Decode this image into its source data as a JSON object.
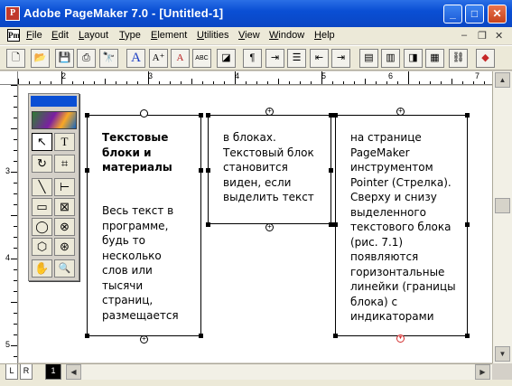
{
  "window": {
    "title": "Adobe PageMaker 7.0 - [Untitled-1]",
    "app_icon": "P",
    "buttons": {
      "minimize": "_",
      "maximize": "□",
      "close": "✕"
    }
  },
  "menu": {
    "doc_icon": "Pm",
    "items": [
      "File",
      "Edit",
      "Layout",
      "Type",
      "Element",
      "Utilities",
      "View",
      "Window",
      "Help"
    ],
    "mdi": {
      "minimize": "–",
      "restore": "❐",
      "close": "✕"
    }
  },
  "toolbar": {
    "buttons": [
      "new-icon",
      "open-icon",
      "save-icon",
      "print-icon",
      "find-icon",
      "character-icon",
      "type-specs-icon",
      "type-specs-color-icon",
      "spelling-icon",
      "fill-stroke-icon",
      "paragraph-icon",
      "indents-tabs-icon",
      "bullets-icon",
      "outdent-icon",
      "indent-icon",
      "master-pages-icon",
      "styles-icon",
      "layers-icon",
      "colors-icon",
      "link-icon",
      "export-pdf-icon"
    ],
    "glyphs": {
      "type": "A",
      "type_specs": "A⁺",
      "type_color": "A",
      "spelling": "ABC",
      "paragraph": "¶"
    }
  },
  "rulers": {
    "horizontal_labels": [
      "2",
      "3",
      "4",
      "5",
      "6",
      "7"
    ],
    "vertical_labels": [
      "3",
      "4",
      "5"
    ]
  },
  "text_blocks": [
    {
      "heading": "Текстовые\nблоки и\nматериалы",
      "body": "Весь текст в\nпрограмме,\nбудь то\nнесколько\nслов или\nтысячи\nстраниц,\nразмещается"
    },
    {
      "heading": "",
      "body": "в блоках.\nТекстовый блок\nстановится\nвиден, если\nвыделить текст"
    },
    {
      "heading": "",
      "body": "на странице\nPageMaker\nинструментом\nPointer (Стрелка).\nСверху и снизу\nвыделенного\nтекстового блока\n(рис. 7.1)\nпоявляются\nгоризонтальные\nлинейки (границы\nблока) с\nиндикаторами"
    }
  ],
  "windowshades": {
    "empty": "",
    "plus": "+",
    "overflow": "▼"
  },
  "toolbox": {
    "tools": [
      {
        "name": "pointer-tool",
        "glyph": "↖"
      },
      {
        "name": "text-tool",
        "glyph": "T"
      },
      {
        "name": "rotate-tool",
        "glyph": "↻"
      },
      {
        "name": "crop-tool",
        "glyph": "⌗"
      },
      {
        "name": "line-tool",
        "glyph": "╲"
      },
      {
        "name": "constrained-line-tool",
        "glyph": "⊢"
      },
      {
        "name": "rectangle-frame-tool",
        "glyph": "▭"
      },
      {
        "name": "rectangle-frame-x-tool",
        "glyph": "⊠"
      },
      {
        "name": "ellipse-tool",
        "glyph": "◯"
      },
      {
        "name": "ellipse-frame-tool",
        "glyph": "⊗"
      },
      {
        "name": "polygon-tool",
        "glyph": "⬡"
      },
      {
        "name": "polygon-frame-tool",
        "glyph": "⊛"
      },
      {
        "name": "hand-tool",
        "glyph": "✋"
      },
      {
        "name": "zoom-tool",
        "glyph": "🔍"
      }
    ]
  },
  "page_tabs": {
    "left": "L",
    "right": "R",
    "page": "1"
  },
  "scroll": {
    "up": "▲",
    "down": "▼",
    "left": "◀",
    "right": "▶"
  }
}
